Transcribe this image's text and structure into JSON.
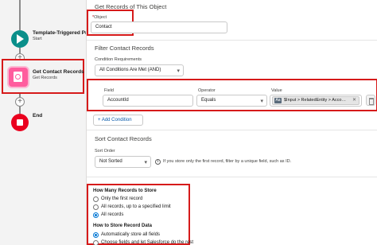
{
  "flow": {
    "start": {
      "title": "Template-Triggered Pr",
      "subtitle": "Start"
    },
    "get_records": {
      "title": "Get Contact Records",
      "subtitle": "Get Records"
    },
    "end": {
      "title": "End"
    },
    "plus_glyph": "+"
  },
  "get_records_section": {
    "title": "Get Records of This Object",
    "object_label_req": "*",
    "object_label": "Object",
    "object_value": "Contact"
  },
  "filter_section": {
    "title": "Filter Contact Records",
    "condition_label": "Condition Requirements",
    "condition_value": "All Conditions Are Met (AND)",
    "columns": {
      "field": "Field",
      "operator": "Operator",
      "value": "Value"
    },
    "row": {
      "field": "AccountId",
      "operator": "Equals",
      "value": "$Input > RelatedEntity > Acco…",
      "value_icon": "Aa"
    },
    "add_condition": "+ Add Condition",
    "remove_glyph": "✕"
  },
  "sort_section": {
    "title": "Sort Contact Records",
    "order_label": "Sort Order",
    "order_value": "Not Sorted",
    "info_glyph": "i",
    "info_text": "If you store only the first record, filter by a unique field, such as ID."
  },
  "store_section": {
    "how_many_title": "How Many Records to Store",
    "options": [
      {
        "label": "Only the first record",
        "selected": false
      },
      {
        "label": "All records, up to a specified limit",
        "selected": false
      },
      {
        "label": "All records",
        "selected": true
      }
    ],
    "how_store_title": "How to Store Record Data",
    "store_options": [
      {
        "label": "Automatically store all fields",
        "selected": true
      },
      {
        "label": "Choose fields and let Salesforce do the rest",
        "selected": false
      }
    ]
  },
  "colors": {
    "accent": "#0176d3",
    "highlight": "#d61a1a",
    "start": "#0a8f8a",
    "end": "#ea001e",
    "get_records": "#ff5d9e"
  }
}
